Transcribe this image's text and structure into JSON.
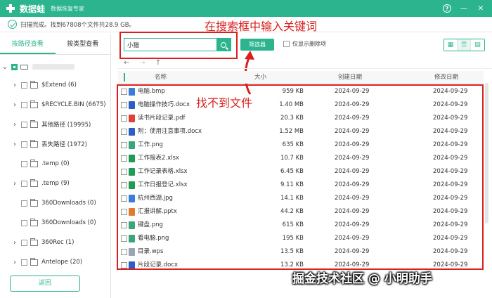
{
  "app": {
    "name": "数据蛙",
    "subtitle": "数据恢复专家"
  },
  "titlebar": {
    "help": "?",
    "minimize": "—",
    "close": "✕"
  },
  "status": {
    "text": "扫描完成。找到67808个文件共28.9 GB。"
  },
  "sidebar": {
    "tabs": [
      {
        "label": "按路径查看",
        "active": true
      },
      {
        "label": "按类型查看",
        "active": false
      }
    ],
    "tree": [
      {
        "label": "$Extend (6)"
      },
      {
        "label": "$RECYCLE.BIN (6675)"
      },
      {
        "label": "其他路径 (19995)"
      },
      {
        "label": "丢失路径 (1972)"
      },
      {
        "label": ".temp (0)"
      },
      {
        "label": ".temp (9)"
      },
      {
        "label": "360Downloads (0)"
      },
      {
        "label": "360Downloads (0)"
      },
      {
        "label": "360Rec (1)"
      },
      {
        "label": "Antelope (20)"
      }
    ],
    "back_label": "返回"
  },
  "toolbar": {
    "search_value": "小猫",
    "filter_label": "筛选器",
    "only_deleted_label": "仅显示删除项"
  },
  "annotations": {
    "search_callout": "在搜索框中输入关键词",
    "notfound_callout": "找不到文件"
  },
  "table": {
    "headers": {
      "name": "名称",
      "size": "大小",
      "created": "创建日期",
      "modified": "修改日期"
    },
    "rows": [
      {
        "name": "电脑.bmp",
        "size": "959 KB",
        "created": "2024-09-29",
        "modified": "2024-09-29",
        "icon": "image-icon",
        "color": "#3b7dd8"
      },
      {
        "name": "电脑操作技巧.docx",
        "size": "1.40 MB",
        "created": "2024-09-29",
        "modified": "2024-09-29",
        "icon": "word-icon",
        "color": "#2b5fc4"
      },
      {
        "name": "读书片段记录.pdf",
        "size": "20.3 KB",
        "created": "2024-09-29",
        "modified": "2024-09-29",
        "icon": "pdf-icon",
        "color": "#e0403a"
      },
      {
        "name": "附：使用注意事项.docx",
        "size": "1.52 MB",
        "created": "2024-09-29",
        "modified": "2024-09-29",
        "icon": "word-icon",
        "color": "#2b5fc4"
      },
      {
        "name": "工作.png",
        "size": "635 KB",
        "created": "2024-09-29",
        "modified": "2024-09-29",
        "icon": "image-icon",
        "color": "#3aa57a"
      },
      {
        "name": "工作报表2.xlsx",
        "size": "10.7 KB",
        "created": "2024-09-29",
        "modified": "2024-09-29",
        "icon": "excel-icon",
        "color": "#1f9b55"
      },
      {
        "name": "工作记录表格.xlsx",
        "size": "6.45 KB",
        "created": "2024-09-29",
        "modified": "2024-09-29",
        "icon": "excel-icon",
        "color": "#1f9b55"
      },
      {
        "name": "工作日报登记.xlsx",
        "size": "9.11 KB",
        "created": "2024-09-29",
        "modified": "2024-09-29",
        "icon": "excel-icon",
        "color": "#1f9b55"
      },
      {
        "name": "杭州西湖.jpg",
        "size": "14.1 KB",
        "created": "2024-09-29",
        "modified": "2024-09-29",
        "icon": "image-icon",
        "color": "#3b7dd8"
      },
      {
        "name": "汇报讲解.pptx",
        "size": "44.2 KB",
        "created": "2024-09-29",
        "modified": "2024-09-29",
        "icon": "ppt-icon",
        "color": "#e07b2e"
      },
      {
        "name": "键盘.png",
        "size": "615 KB",
        "created": "2024-09-29",
        "modified": "2024-09-29",
        "icon": "image-icon",
        "color": "#3aa57a"
      },
      {
        "name": "看电脑.png",
        "size": "195 KB",
        "created": "2024-09-29",
        "modified": "2024-09-29",
        "icon": "image-icon",
        "color": "#3aa57a"
      },
      {
        "name": "目录.wps",
        "size": "13.5 KB",
        "created": "2024-09-29",
        "modified": "2024-09-29",
        "icon": "wps-icon",
        "color": "#9aa5b4"
      },
      {
        "name": "片段记录.docx",
        "size": "13.2 KB",
        "created": "2024-09-29",
        "modified": "2024-09-29",
        "icon": "word-icon",
        "color": "#2b5fc4"
      }
    ]
  },
  "watermark": "掘金技术社区 @ 小明助手"
}
